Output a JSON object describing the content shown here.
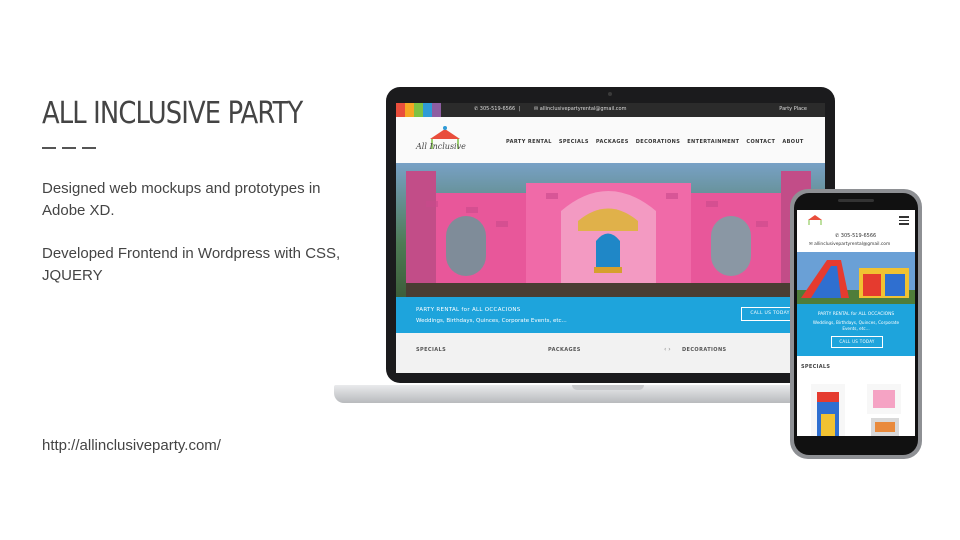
{
  "slide": {
    "title": "ALL INCLUSIVE PARTY",
    "description_1": "Designed web mockups and prototypes in Adobe XD.",
    "description_2": "Developed Frontend in Wordpress with CSS, JQUERY",
    "url": "http://allinclusiveparty.com/"
  },
  "desktop_site": {
    "topbar": {
      "phone": "305-519-6566",
      "email": "allinclusivepartyrental@gmail.com",
      "right_text": "Party Place"
    },
    "logo_text": "All Inclusive",
    "nav": [
      "PARTY RENTAL",
      "SPECIALS",
      "PACKAGES",
      "DECORATIONS",
      "ENTERTAINMENT",
      "CONTACT",
      "ABOUT"
    ],
    "band": {
      "headline": "PARTY RENTAL for ALL OCCACIONS",
      "subline": "Weddings, Birthdays, Quinces, Corporate Events, etc...",
      "button": "CALL US TODAY"
    },
    "categories": [
      "SPECIALS",
      "PACKAGES",
      "DECORATIONS"
    ],
    "arrows": "‹ ›"
  },
  "mobile_site": {
    "phone": "305-519-6566",
    "email": "allinclusivepartyrental@gmail.com",
    "band": {
      "headline": "PARTY RENTAL for ALL OCCACIONS",
      "subline_1": "Weddings, Birthdays, Quinces, Corporate",
      "subline_2": "Events, etc...",
      "button": "CALL US TODAY"
    },
    "specials_label": "SPECIALS"
  },
  "colors": {
    "brand_blue": "#1ea4dc",
    "topbar_stripes": [
      "#e94e3c",
      "#f6a623",
      "#7dc242",
      "#2f9bd7",
      "#8e5ea2"
    ],
    "castle_pink": "#e8579a"
  },
  "icons": [
    "facebook-icon",
    "google-plus-icon",
    "rss-icon",
    "hamburger-menu-icon",
    "phone-icon",
    "email-icon"
  ]
}
